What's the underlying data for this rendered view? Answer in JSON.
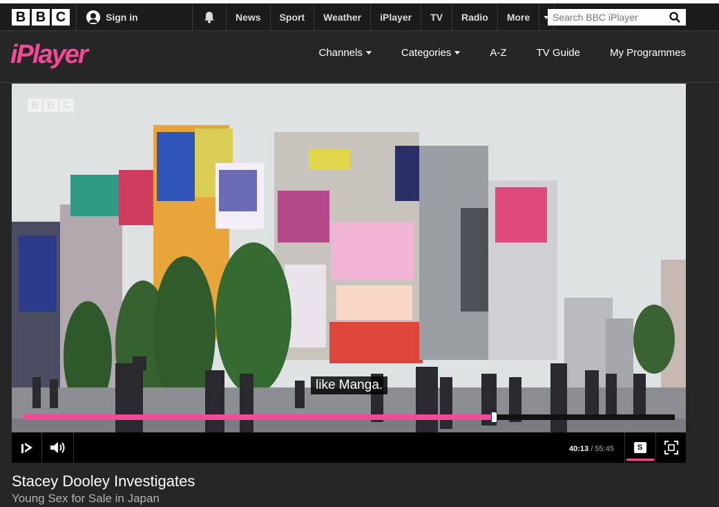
{
  "topbar": {
    "bbc_letters": [
      "B",
      "B",
      "C"
    ],
    "sign_in_label": "Sign in",
    "nav": [
      "News",
      "Sport",
      "Weather",
      "iPlayer",
      "TV",
      "Radio",
      "More"
    ],
    "search_placeholder": "Search BBC iPlayer"
  },
  "iplayer": {
    "logo": "iPlayer",
    "nav": [
      "Channels",
      "Categories",
      "A-Z",
      "TV Guide",
      "My Programmes"
    ]
  },
  "player": {
    "watermark": [
      "B",
      "B",
      "C"
    ],
    "subtitle_text": "like Manga.",
    "progress_fraction": 0.722,
    "current_time": "40:13",
    "duration": "/ 55:45",
    "subtitles_label": "S"
  },
  "programme": {
    "title": "Stacey Dooley Investigates",
    "episode": "Young Sex for Sale in Japan"
  },
  "colors": {
    "accent": "#f54997",
    "background": "#262626",
    "topbar": "#1b1b1b"
  }
}
